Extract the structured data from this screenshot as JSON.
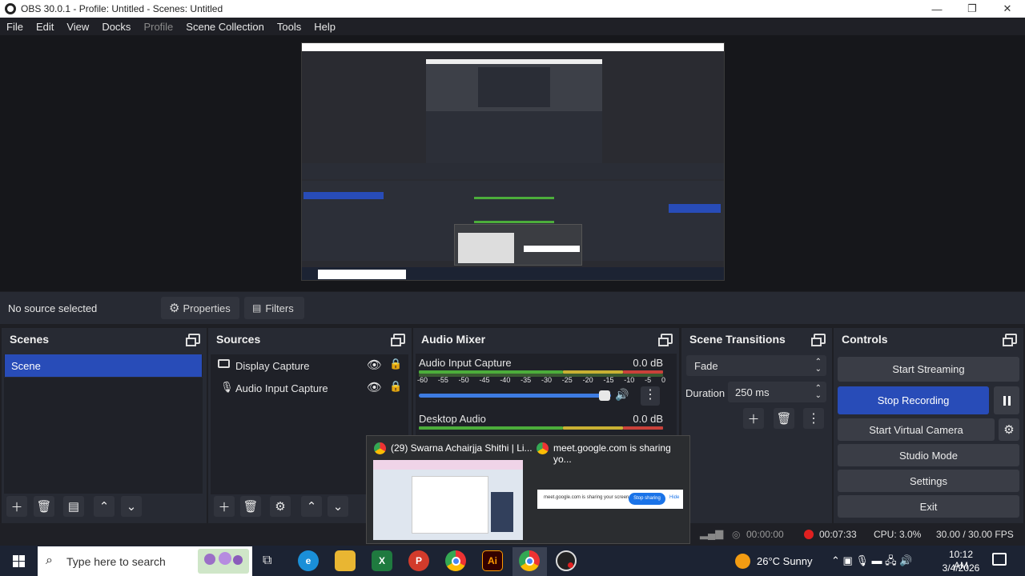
{
  "window": {
    "title": "OBS 30.0.1 - Profile: Untitled - Scenes: Untitled",
    "minimize": "—",
    "restore": "❐",
    "close": "✕"
  },
  "menu": [
    "File",
    "Edit",
    "View",
    "Docks",
    "Profile",
    "Scene Collection",
    "Tools",
    "Help"
  ],
  "source_toolbar": {
    "status": "No source selected",
    "properties": "Properties",
    "filters": "Filters"
  },
  "scenes": {
    "title": "Scenes",
    "items": [
      "Scene"
    ]
  },
  "sources": {
    "title": "Sources",
    "items": [
      "Display Capture",
      "Audio Input Capture"
    ]
  },
  "mixer": {
    "title": "Audio Mixer",
    "channels": [
      {
        "name": "Audio Input Capture",
        "db": "0.0 dB"
      },
      {
        "name": "Desktop Audio",
        "db": "0.0 dB"
      }
    ],
    "scale": [
      "-60",
      "-55",
      "-50",
      "-45",
      "-40",
      "-35",
      "-30",
      "-25",
      "-20",
      "-15",
      "-10",
      "-5",
      "0"
    ]
  },
  "transitions": {
    "title": "Scene Transitions",
    "type": "Fade",
    "duration_label": "Duration",
    "duration_value": "250 ms"
  },
  "controls": {
    "title": "Controls",
    "start_streaming": "Start Streaming",
    "stop_recording": "Stop Recording",
    "start_virtual_camera": "Start Virtual Camera",
    "studio_mode": "Studio Mode",
    "settings": "Settings",
    "exit": "Exit"
  },
  "status": {
    "stream_time": "00:00:00",
    "rec_time": "00:07:33",
    "cpu": "CPU: 3.0%",
    "fps": "30.00 / 30.00 FPS"
  },
  "thumbs": {
    "first_title": "(29) Swarna Achairjja Shithi | Li...",
    "second_title": "meet.google.com is sharing yo...",
    "sharing_text": "meet.google.com is sharing your screen.",
    "stop_sharing": "Stop sharing",
    "hide": "Hide"
  },
  "taskbar": {
    "search_placeholder": "Type here to search",
    "weather": "26°C  Sunny",
    "time": "10:12 AM",
    "date": "3/4/2026"
  },
  "colors": {
    "accent_blue": "#284cb8",
    "panel": "#272a33",
    "meter_green": "#4cad3b",
    "meter_yellow": "#c8b133",
    "meter_red": "#c9413a",
    "rec_red": "#e02020"
  }
}
